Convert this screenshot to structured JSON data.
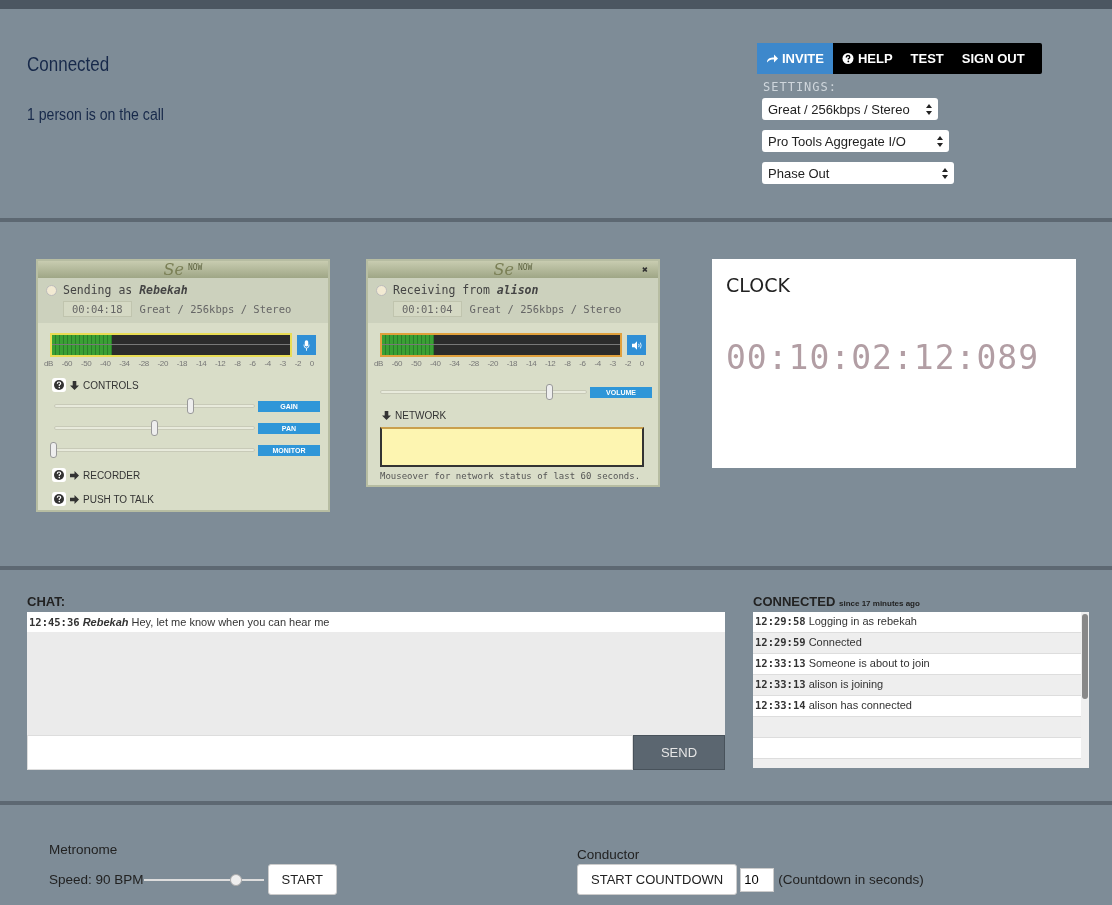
{
  "header": {
    "status": "Connected",
    "people": "1 person is on the call",
    "nav": [
      {
        "label": "INVITE",
        "kind": "invite",
        "selected": true
      },
      {
        "label": "HELP",
        "kind": "help",
        "selected": false
      },
      {
        "label": "TEST",
        "kind": "plain",
        "selected": false
      },
      {
        "label": "SIGN OUT",
        "kind": "plain",
        "selected": false
      }
    ],
    "settings_label": "SETTINGS:",
    "selects": [
      "Great / 256kbps / Stereo",
      "Pro Tools Aggregate I/O",
      "Phase Out"
    ]
  },
  "sender": {
    "logo": "Se",
    "logo_tag": "NOW",
    "prefix": "Sending as",
    "name": "Rebekah",
    "time": "00:04:18",
    "quality": "Great / 256kbps / Stereo",
    "meter": {
      "level": 0.25
    },
    "scale": [
      "dB",
      "-60",
      "-50",
      "-40",
      "-34",
      "-28",
      "-20",
      "-18",
      "-14",
      "-12",
      "-8",
      "-6",
      "-4",
      "-3",
      "-2",
      "0"
    ],
    "controls": {
      "label": "CONTROLS",
      "expanded": true
    },
    "sliders": [
      {
        "label": "GAIN",
        "level": 0.68
      },
      {
        "label": "PAN",
        "level": 0.5
      },
      {
        "label": "MONITOR",
        "level": 0.0
      }
    ],
    "sections": [
      {
        "label": "RECORDER",
        "expanded": false
      },
      {
        "label": "PUSH TO TALK",
        "expanded": false
      }
    ]
  },
  "receiver": {
    "logo": "Se",
    "logo_tag": "NOW",
    "close": "✖",
    "prefix": "Receiving from",
    "name": "alison",
    "time": "00:01:04",
    "quality": "Great / 256kbps / Stereo",
    "meter": {
      "level": 0.22
    },
    "scale": [
      "dB",
      "-60",
      "-50",
      "-40",
      "-34",
      "-28",
      "-20",
      "-18",
      "-14",
      "-12",
      "-8",
      "-6",
      "-4",
      "-3",
      "-2",
      "0"
    ],
    "volume": {
      "label": "VOLUME",
      "level": 0.82
    },
    "network": {
      "label": "NETWORK",
      "expanded": true
    },
    "note": "Mouseover for network status of last 60 seconds."
  },
  "clock": {
    "title": "CLOCK",
    "time": "00:10:02:12:089"
  },
  "chat": {
    "label": "CHAT:",
    "messages": [
      {
        "time": "12:45:36",
        "user": "Rebekah",
        "text": "Hey, let me know when you can hear me"
      }
    ],
    "send": "SEND"
  },
  "connected": {
    "title": "CONNECTED",
    "since": "since 17 minutes ago",
    "log": [
      {
        "time": "12:29:58",
        "text": "Logging in as rebekah"
      },
      {
        "time": "12:29:59",
        "text": "Connected"
      },
      {
        "time": "12:33:13",
        "text": "Someone is about to join"
      },
      {
        "time": "12:33:13",
        "text": "alison is joining"
      },
      {
        "time": "12:33:14",
        "text": "alison has connected"
      }
    ]
  },
  "metronome": {
    "title": "Metronome",
    "speed": "Speed: 90 BPM",
    "level": 0.77,
    "button": "START"
  },
  "conductor": {
    "title": "Conductor",
    "button": "START COUNTDOWN",
    "value": "10",
    "hint": "(Countdown in seconds)"
  }
}
